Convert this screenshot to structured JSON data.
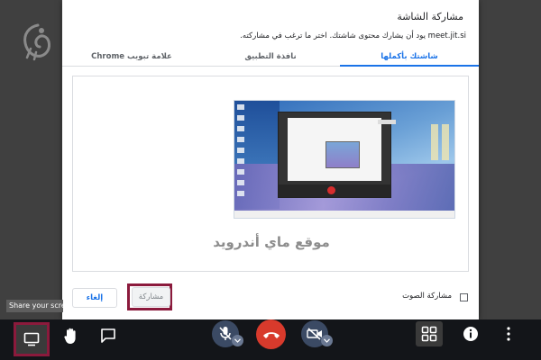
{
  "dialog": {
    "title": "مشاركة الشاشة",
    "subtitle": "meet.jit.si يود أن يشارك محتوى شاشتك. اختر ما ترغب في مشاركته.",
    "tabs": [
      {
        "label": "شاشتك بأكملها",
        "active": true
      },
      {
        "label": "نافذة التطبيق",
        "active": false
      },
      {
        "label": "علامة تبويب Chrome",
        "active": false
      }
    ],
    "watermark": "موقع ماي أندرويد",
    "audio_share_label": "مشاركة الصوت",
    "share_button": "مشاركة",
    "cancel_button": "إلغاء"
  },
  "tooltip": "Share your screen",
  "toolbar": {
    "icons": [
      "screen-share-icon",
      "raise-hand-icon",
      "chat-icon",
      "mic-off-icon",
      "hangup-icon",
      "camera-off-icon",
      "tile-view-icon",
      "info-icon",
      "more-icon"
    ]
  },
  "colors": {
    "accent": "#1a73e8",
    "highlight": "#8b1a3c",
    "hangup": "#d83a2c",
    "toolbar_bg": "#131519"
  }
}
